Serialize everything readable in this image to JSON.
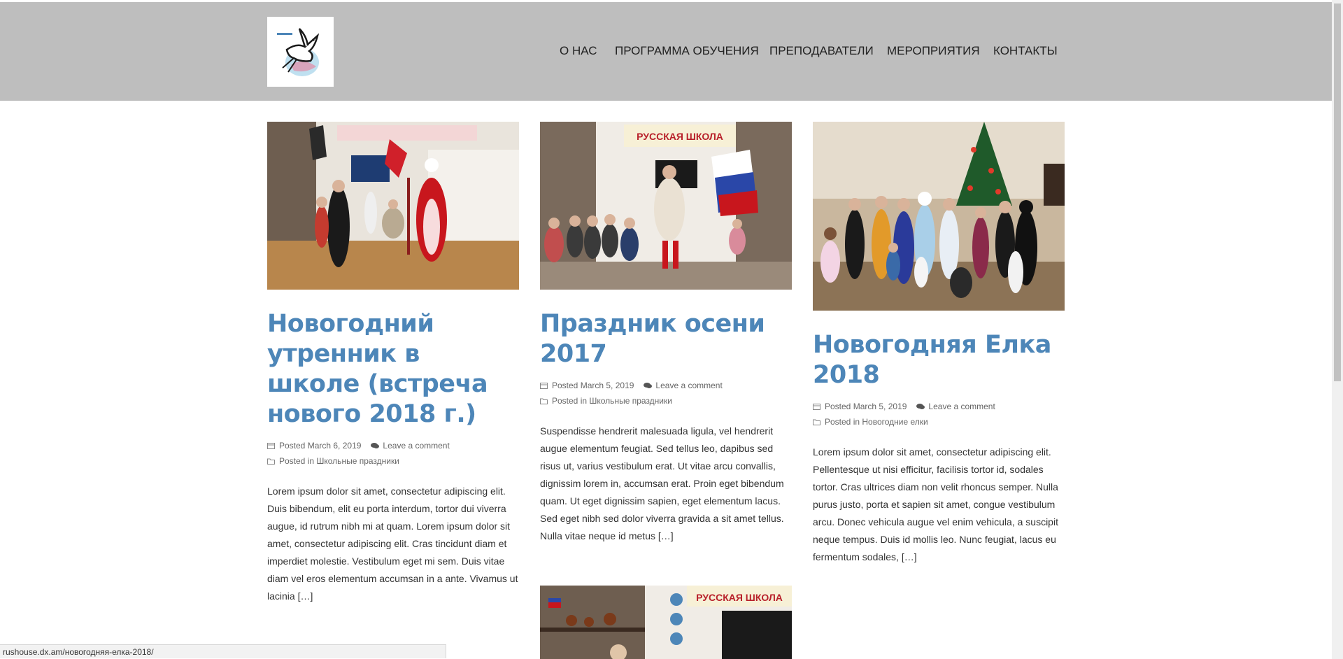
{
  "header": {
    "logo_alt": "dove logo",
    "nav": [
      "О НАС",
      "ПРОГРАММА ОБУЧЕНИЯ",
      "ПРЕПОДАВАТЕЛИ",
      "МЕРОПРИЯТИЯ",
      "КОНТАКТЫ"
    ]
  },
  "posts": [
    {
      "title": "Новогодний утренник в школе (встреча нового 2018 г.)",
      "posted_prefix": "Posted",
      "date": "March 6, 2019",
      "comment_link": "Leave a comment",
      "posted_in_prefix": "Posted in",
      "category": "Школьные праздники",
      "excerpt": "Lorem ipsum dolor sit amet, consectetur adipiscing elit. Duis bibendum, elit eu porta interdum, tortor dui viverra augue, id rutrum nibh mi at quam. Lorem ipsum dolor sit amet, consectetur adipiscing elit. Cras tincidunt diam et imperdiet molestie. Vestibulum eget mi sem. Duis vitae diam vel eros elementum accumsan in a ante. Vivamus ut lacinia […]"
    },
    {
      "title": "Праздник осени 2017",
      "posted_prefix": "Posted",
      "date": "March 5, 2019",
      "comment_link": "Leave a comment",
      "posted_in_prefix": "Posted in",
      "category": "Школьные праздники",
      "excerpt": "Suspendisse hendrerit malesuada ligula, vel hendrerit augue elementum feugiat. Sed tellus leo, dapibus sed risus ut, varius vestibulum erat. Ut vitae arcu convallis, dignissim lorem in, accumsan erat. Proin eget bibendum quam. Ut eget dignissim sapien, eget elementum lacus. Sed eget nibh sed dolor viverra gravida a sit amet tellus. Nulla vitae neque id metus […]"
    },
    {
      "title": "Новогодняя Елка 2018",
      "posted_prefix": "Posted",
      "date": "March 5, 2019",
      "comment_link": "Leave a comment",
      "posted_in_prefix": "Posted in",
      "category": "Новогодние елки",
      "excerpt": "Lorem ipsum dolor sit amet, consectetur adipiscing elit. Pellentesque ut nisi efficitur, facilisis tortor id, sodales tortor. Cras ultrices diam non velit rhoncus semper. Nulla purus justo, porta et sapien sit amet, congue vestibulum arcu. Donec vehicula augue vel enim vehicula, a suscipit neque tempus. Duis id mollis leo. Nunc feugiat, lacus eu fermentum sodales, […]"
    }
  ],
  "photo_banner_text": "РУССКАЯ ШКОЛА",
  "status_url": "rushouse.dx.am/новогодняя-елка-2018/",
  "colors": {
    "header_bg": "#bebebe",
    "title_link": "#4d86b8"
  }
}
